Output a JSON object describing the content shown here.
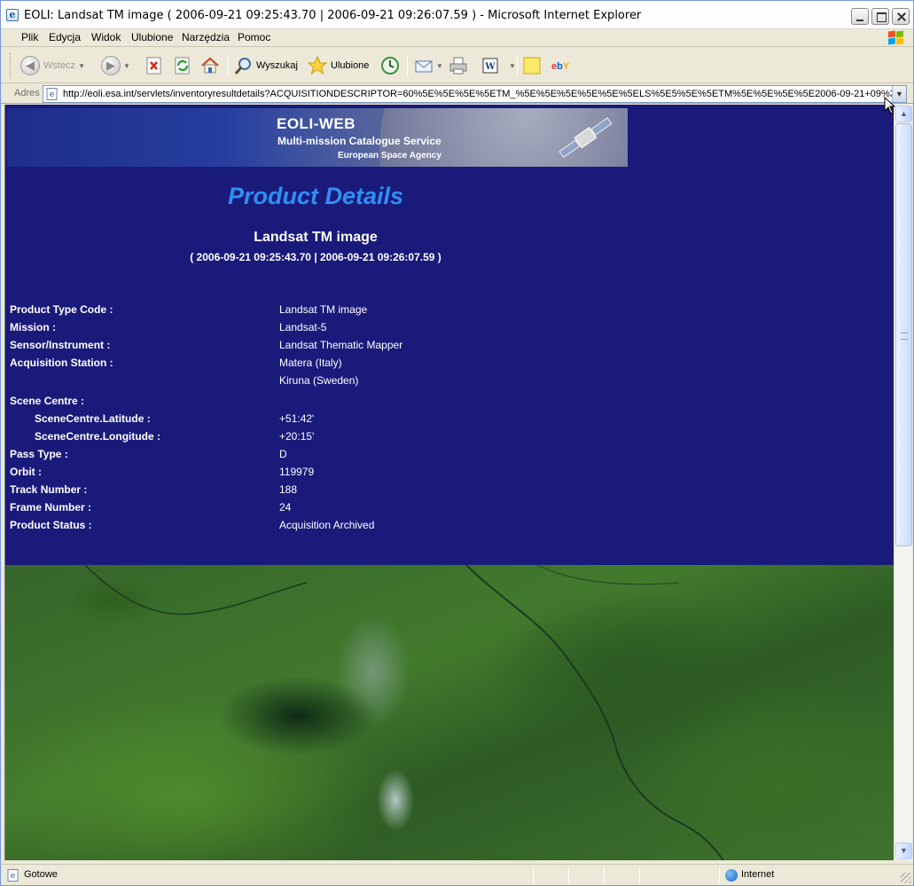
{
  "window": {
    "title": "EOLI: Landsat TM image ( 2006-09-21 09:25:43.70 | 2006-09-21 09:26:07.59 ) - Microsoft Internet Explorer"
  },
  "menu": {
    "items": [
      "Plik",
      "Edycja",
      "Widok",
      "Ulubione",
      "Narzędzia",
      "Pomoc"
    ]
  },
  "toolbar": {
    "back_label": "Wstecz",
    "search_label": "Wyszukaj",
    "favorites_label": "Ulubione"
  },
  "address": {
    "label": "Adres",
    "url": "http://eoli.esa.int/servlets/inventoryresultdetails?ACQUISITIONDESCRIPTOR=60%5E%5E%5E%5ETM_%5E%5E%5E%5E%5E%5ELS%5E5%5E%5ETM%5E%5E%5E%5E2006-09-21+09%3A"
  },
  "banner": {
    "title": "EOLI-WEB",
    "subtitle": "Multi-mission Catalogue Service",
    "agency": "European Space Agency"
  },
  "page": {
    "heading": "Product Details",
    "product_name": "Landsat TM image",
    "time_range": "( 2006-09-21 09:25:43.70 | 2006-09-21 09:26:07.59 )"
  },
  "details": [
    {
      "key": "Product Type Code :",
      "value": "Landsat TM image"
    },
    {
      "key": "Mission :",
      "value": "Landsat-5"
    },
    {
      "key": "Sensor/Instrument :",
      "value": "Landsat Thematic Mapper"
    },
    {
      "key": "Acquisition Station :",
      "value": "Matera (Italy)"
    },
    {
      "key": "",
      "value": "Kiruna (Sweden)"
    },
    {
      "key": "Scene Centre :",
      "value": ""
    },
    {
      "key": "SceneCentre.Latitude :",
      "value": "+51:42'"
    },
    {
      "key": "SceneCentre.Longitude :",
      "value": "+20:15'"
    },
    {
      "key": "Pass Type :",
      "value": "D"
    },
    {
      "key": "Orbit :",
      "value": "119979"
    },
    {
      "key": "Track Number :",
      "value": "188"
    },
    {
      "key": "Frame Number :",
      "value": "24"
    },
    {
      "key": "Product Status :",
      "value": "Acquisition Archived"
    }
  ],
  "status": {
    "text": "Gotowe",
    "zone": "Internet"
  }
}
